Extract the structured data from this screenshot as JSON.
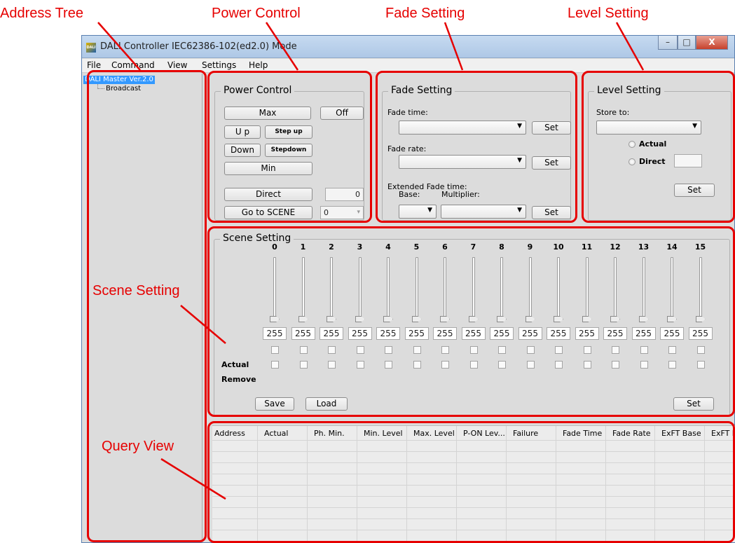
{
  "callouts": {
    "address_tree": "Address Tree",
    "power_control": "Power Control",
    "fade_setting": "Fade Setting",
    "level_setting": "Level Setting",
    "scene_setting": "Scene Setting",
    "query_view": "Query View"
  },
  "window": {
    "title": "DALI Controller IEC62386-102(ed2.0) Mode",
    "icon_text": "DALI",
    "minimize": "–",
    "maximize": "□",
    "close": "X"
  },
  "menu": [
    "File",
    "Command",
    "View",
    "Settings",
    "Help"
  ],
  "tree": {
    "root": "DALI Master Ver.2.0",
    "child": "Broadcast"
  },
  "power": {
    "title": "Power Control",
    "max": "Max",
    "off": "Off",
    "up": "U p",
    "step_up": "Step up",
    "down": "Down",
    "step_down": "Stepdown",
    "min": "Min",
    "direct": "Direct",
    "direct_value": "0",
    "goto_scene": "Go to SCENE",
    "scene_value": "0"
  },
  "fade": {
    "title": "Fade Setting",
    "fade_time": "Fade time:",
    "fade_rate": "Fade rate:",
    "extended": "Extended Fade time:",
    "base": "Base:",
    "multiplier": "Multiplier:",
    "set": "Set"
  },
  "level": {
    "title": "Level Setting",
    "store_to": "Store to:",
    "actual": "Actual",
    "direct": "Direct",
    "set": "Set"
  },
  "scene": {
    "title": "Scene Setting",
    "numbers": [
      "0",
      "1",
      "2",
      "3",
      "4",
      "5",
      "6",
      "7",
      "8",
      "9",
      "10",
      "11",
      "12",
      "13",
      "14",
      "15"
    ],
    "values": [
      "255",
      "255",
      "255",
      "255",
      "255",
      "255",
      "255",
      "255",
      "255",
      "255",
      "255",
      "255",
      "255",
      "255",
      "255",
      "255"
    ],
    "actual_label": "Actual",
    "remove_label": "Remove",
    "save": "Save",
    "load": "Load",
    "set": "Set"
  },
  "query": {
    "columns": [
      "Address",
      "Actual",
      "Ph. Min.",
      "Min. Level",
      "Max. Level",
      "P-ON Lev...",
      "Failure",
      "Fade Time",
      "Fade Rate",
      "ExFT Base",
      "ExFT M"
    ]
  },
  "colors": {
    "callout": "#e60000",
    "selection": "#3399ff",
    "window_bg": "#dcdcdc"
  }
}
